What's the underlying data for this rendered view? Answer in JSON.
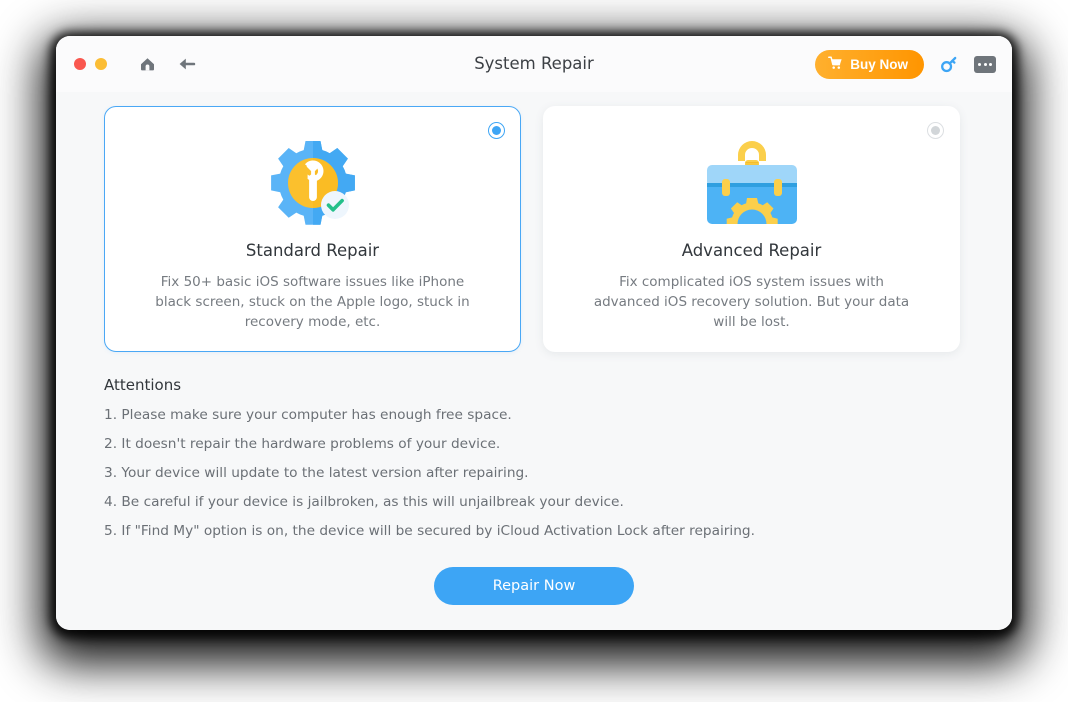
{
  "window": {
    "title": "System Repair",
    "traffic_lights": [
      {
        "name": "close",
        "color": "#f9574f"
      },
      {
        "name": "minimize",
        "color": "#fbbd35"
      }
    ],
    "nav": {
      "home_icon": "home-icon",
      "back_icon": "back-arrow-icon"
    },
    "actions": {
      "buy_label": "Buy Now",
      "buy_icon": "shopping-cart-icon",
      "buy_color": "#ff9500",
      "key_icon": "key-icon",
      "key_color": "#3da5f5",
      "more_icon": "more-options-icon"
    }
  },
  "options": [
    {
      "id": "standard",
      "title": "Standard Repair",
      "description": "Fix 50+ basic iOS software issues like iPhone black screen, stuck on the Apple logo, stuck in recovery mode, etc.",
      "icon": "gear-wrench-check-icon",
      "selected": true
    },
    {
      "id": "advanced",
      "title": "Advanced Repair",
      "description": "Fix complicated iOS system issues with advanced iOS recovery solution. But your data will be lost.",
      "icon": "toolbox-gear-icon",
      "selected": false
    }
  ],
  "attentions": {
    "heading": "Attentions",
    "items": [
      "1. Please make sure your computer has enough free space.",
      "2. It doesn't repair the hardware problems of your device.",
      "3. Your device will update to the latest version after repairing.",
      "4. Be careful if your device is jailbroken, as this will unjailbreak your device.",
      "5. If \"Find My\" option is on, the device will be secured by iCloud Activation Lock after repairing."
    ]
  },
  "footer": {
    "primary_label": "Repair Now",
    "primary_color": "#3da5f5"
  }
}
